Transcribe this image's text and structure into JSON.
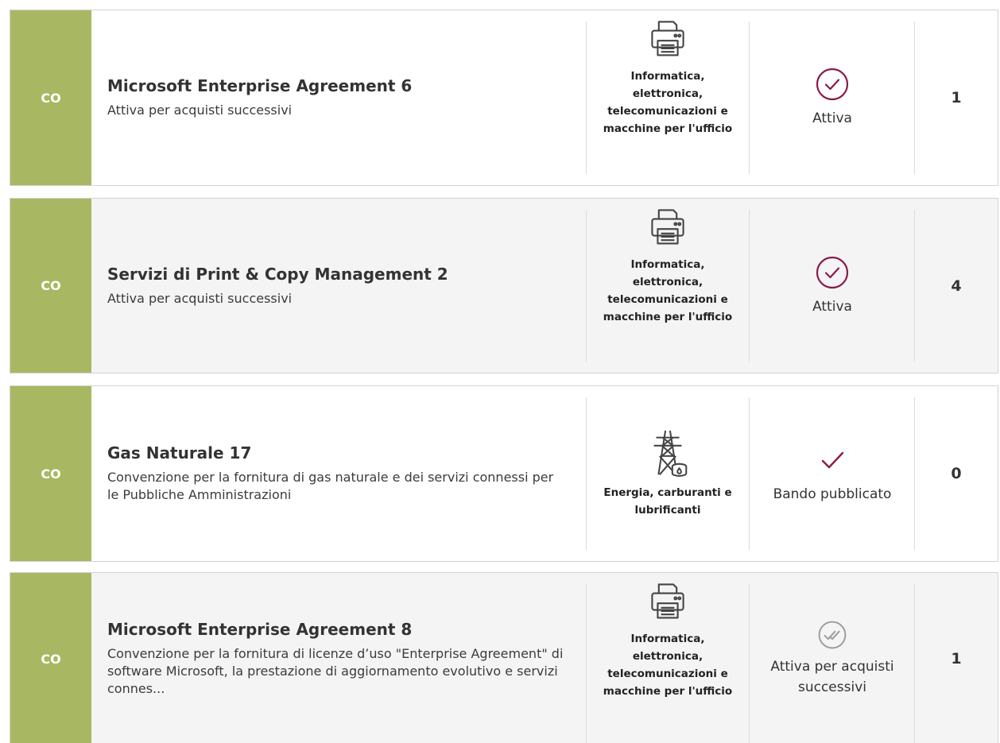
{
  "colors": {
    "badge": "#a8b862",
    "accent": "#8b1a4a",
    "muted": "#9a9a9a"
  },
  "items": [
    {
      "badge": "CO",
      "title": "Microsoft Enterprise Agreement 6",
      "description": "Attiva per acquisti successivi",
      "category": "Informatica, elettronica, telecomunicazioni e macchine per l'ufficio",
      "category_icon": "printer-icon",
      "status": "Attiva",
      "status_icon": "check-circle-icon",
      "count": "1"
    },
    {
      "badge": "CO",
      "title": "Servizi di Print & Copy Management 2",
      "description": "Attiva per acquisti successivi",
      "category": "Informatica, elettronica, telecomunicazioni e macchine per l'ufficio",
      "category_icon": "printer-icon",
      "status": "Attiva",
      "status_icon": "check-circle-icon",
      "count": "4"
    },
    {
      "badge": "CO",
      "title": "Gas Naturale 17",
      "description": "Convenzione per la fornitura di gas naturale e dei servizi connessi per le Pubbliche Amministrazioni",
      "category": "Energia, carburanti e lubrificanti",
      "category_icon": "power-tower-icon",
      "status": "Bando pubblicato",
      "status_icon": "check-icon",
      "count": "0"
    },
    {
      "badge": "CO",
      "title": "Microsoft Enterprise Agreement 8",
      "description": "Convenzione per la fornitura di licenze d’uso \"Enterprise Agreement\" di software Microsoft, la prestazione di aggiornamento evolutivo e servizi connes...",
      "category": "Informatica, elettronica, telecomunicazioni e macchine per l'ufficio",
      "category_icon": "printer-icon",
      "status": "Attiva per acquisti successivi",
      "status_icon": "double-check-circle-icon",
      "count": "1"
    }
  ]
}
